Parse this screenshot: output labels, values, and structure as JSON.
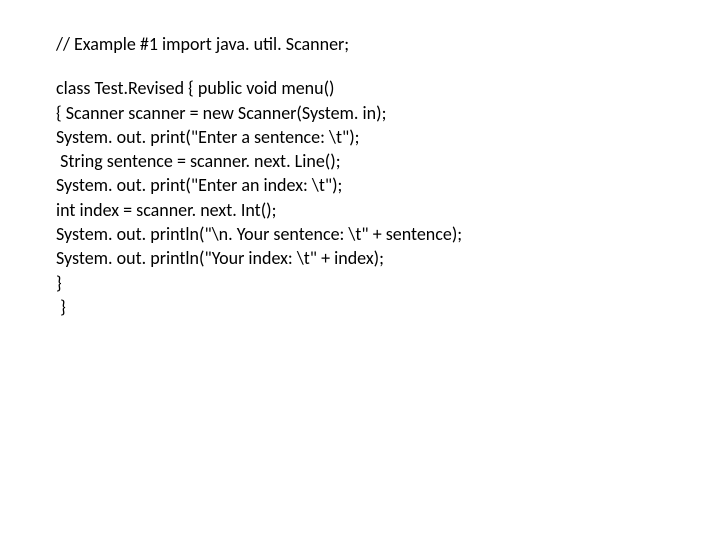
{
  "code": {
    "comment": "// Example #1 import java. util. Scanner;",
    "lines": [
      "class Test.Revised { public void menu()",
      "{ Scanner scanner = new Scanner(System. in);",
      "System. out. print(\"Enter a sentence: \\t\");",
      " String sentence = scanner. next. Line();",
      "System. out. print(\"Enter an index: \\t\");",
      "int index = scanner. next. Int();",
      "System. out. println(\"\\n. Your sentence: \\t\" + sentence);",
      "System. out. println(\"Your index: \\t\" + index);",
      "}",
      " }"
    ]
  }
}
